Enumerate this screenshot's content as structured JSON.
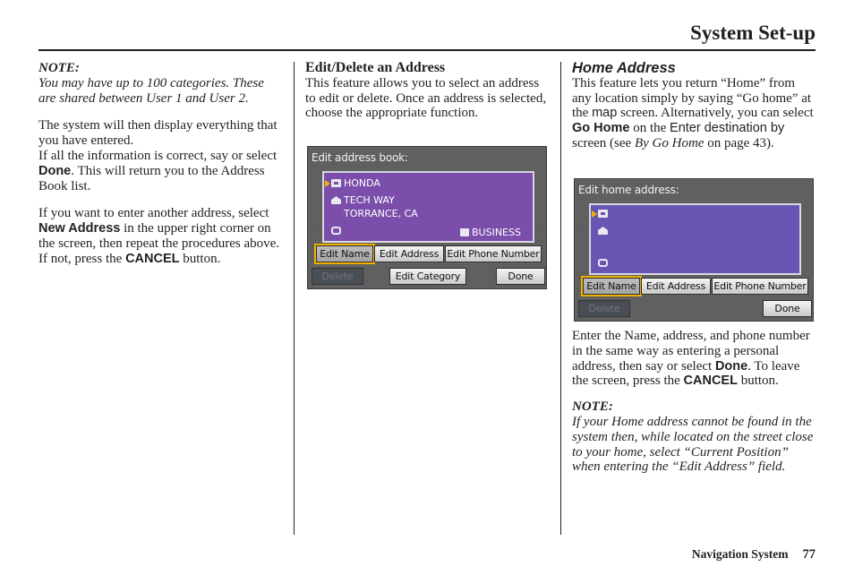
{
  "header": {
    "title": "System Set-up"
  },
  "left": {
    "note_title": "NOTE:",
    "note_text": "You may have up to 100 categories. These are shared between User 1 and User 2.",
    "p1": "The system will then display everything that you have entered.",
    "p2_before": "If all the information is correct, say or select ",
    "p2_bold": "Done",
    "p2_after": ". This will return you to the Address Book list.",
    "p3_before": "If you want to enter another address, select ",
    "p3_bold": "New Address",
    "p3_mid": " in the upper right corner on the screen, then repeat the procedures above. If not, press the ",
    "p3_bold2": "CANCEL",
    "p3_after": " button."
  },
  "middle": {
    "heading": "Edit/Delete an Address",
    "text": "This feature allows you to select an address to edit or delete. Once an address is selected, choose the appropriate function.",
    "screen": {
      "title": "Edit address book:",
      "name": "HONDA",
      "address_line1": "TECH WAY",
      "address_line2": "TORRANCE, CA",
      "phone": "",
      "category": "BUSINESS",
      "buttons": {
        "edit_name": "Edit Name",
        "edit_address": "Edit Address",
        "edit_phone": "Edit Phone Number",
        "delete": "Delete",
        "edit_category": "Edit Category",
        "done": "Done"
      }
    }
  },
  "right": {
    "heading": "Home Address",
    "p1_a": "This feature lets you return “Home” from any location simply by saying “Go home” at the ",
    "p1_map": "map",
    "p1_b": " screen. Alternatively, you can select ",
    "p1_gohome": "Go Home",
    "p1_c": " on the ",
    "p1_enter": "Enter destination by",
    "p1_d": " screen (see ",
    "p1_ref": "By Go Home",
    "p1_e": " on page 43).",
    "screen": {
      "title": "Edit home address:",
      "buttons": {
        "edit_name": "Edit Name",
        "edit_address": "Edit Address",
        "edit_phone": "Edit Phone Number",
        "delete": "Delete",
        "done": "Done"
      }
    },
    "p2_a": "Enter the Name, address, and phone number in the same way as entering a personal address, then say or select ",
    "p2_done": "Done",
    "p2_b": ". To leave the screen, press the ",
    "p2_cancel": "CANCEL",
    "p2_c": " button.",
    "note_title": "NOTE:",
    "note_text": "If your Home address cannot be found in the system then, while located on the street close to your home, select “Current Position” when entering the “Edit Address” field."
  },
  "footer": {
    "section": "Navigation System",
    "page": "77"
  }
}
